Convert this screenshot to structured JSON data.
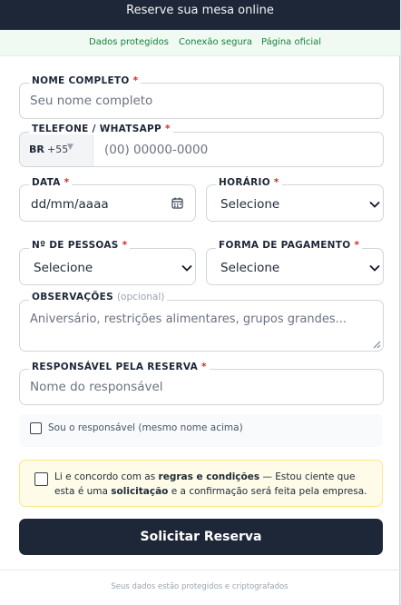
{
  "header": {
    "title": "Reserve sua mesa online"
  },
  "trust": [
    "Dados protegidos",
    "Conexão segura",
    "Página oficial"
  ],
  "form": {
    "name": {
      "label": "NOME COMPLETO",
      "placeholder": "Seu nome completo"
    },
    "phone": {
      "label": "TELEFONE / WHATSAPP",
      "country": "BR",
      "dial": "+55",
      "placeholder": "(00) 00000-0000"
    },
    "date": {
      "label": "DATA",
      "placeholder": "dd/mm/aaaa"
    },
    "time": {
      "label": "HORÁRIO",
      "value": "Selecione"
    },
    "people": {
      "label": "Nº DE PESSOAS",
      "value": "Selecione"
    },
    "payment": {
      "label": "FORMA DE PAGAMENTO",
      "value": "Selecione"
    },
    "notes": {
      "label": "OBSERVAÇÕES",
      "optional": "(opcional)",
      "placeholder": "Aniversário, restrições alimentares, grupos grandes..."
    },
    "responsible": {
      "label": "RESPONSÁVEL PELA RESERVA",
      "placeholder": "Nome do responsável"
    },
    "same_person": {
      "label": "Sou o responsável (mesmo nome acima)"
    },
    "terms": {
      "t1": "Li e concordo com as ",
      "t2": "regras e condições",
      "t3": " — Estou ciente que esta é uma ",
      "t4": "solicitação",
      "t5": " e a confirmação será feita pela empresa."
    },
    "required_mark": "*",
    "submit": "Solicitar Reserva"
  },
  "footer": "Seus dados estão protegidos e criptografados",
  "colors": {
    "navy": "#1e2738",
    "green": "#15803d",
    "required": "#dc2626",
    "terms_bg": "#fefce8"
  },
  "icons": [
    "calendar-icon",
    "chevron-down-icon",
    "dropdown-arrow-icon"
  ]
}
